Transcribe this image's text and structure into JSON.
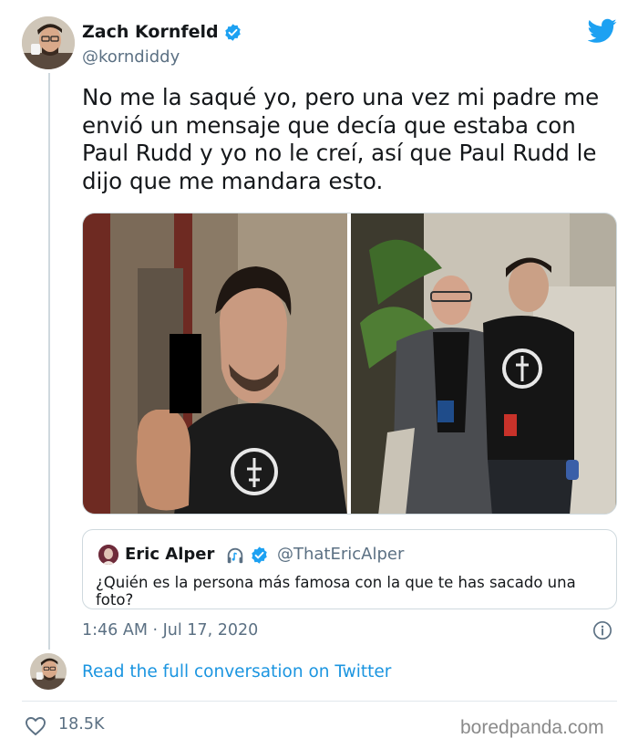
{
  "tweet": {
    "author_name": "Zach Kornfeld",
    "author_handle": "@korndiddy",
    "text": "No me la saqué yo, pero una vez mi padre me envió un mensaje que decía que estaba con Paul Rudd y yo no le creí, así que Paul Rudd le dijo que me mandara esto.",
    "timestamp": "1:46 AM · Jul 17, 2020",
    "read_link": "Read the full conversation on Twitter",
    "like_count": "18.5K"
  },
  "quote": {
    "author_name": "Eric Alper",
    "author_handle": "@ThatEricAlper",
    "text": "¿Quién es la persona más famosa con la que te has sacado una foto?"
  },
  "icons": {
    "brand": "twitter-bird-icon",
    "verified": "verified-badge-icon",
    "info": "info-icon",
    "like": "heart-icon",
    "quote_extra": "headphones-icon"
  },
  "colors": {
    "accent": "#1da1f2",
    "link": "#1b95e0",
    "text": "#14171a",
    "secondary": "#5b7083",
    "border": "#cfd9de"
  },
  "watermark": "boredpanda.com"
}
